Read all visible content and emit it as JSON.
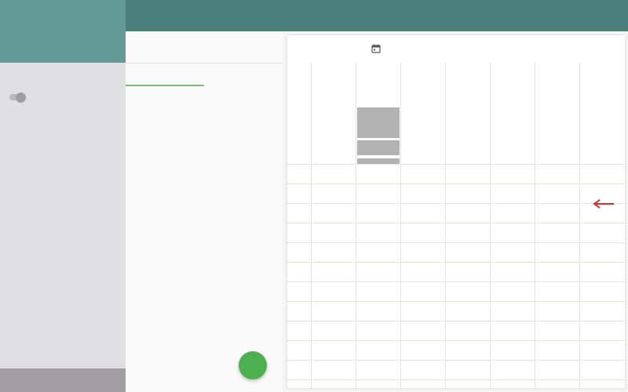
{
  "colors": {
    "topbar": "#4a7f7c",
    "sidebar_header": "#649a97",
    "sidebar": "#e0dfe1",
    "fab": "#4caf50",
    "tab_indicator": "#7dbb83",
    "event_block": "#b3b3b3",
    "arrow": "#d32f2f"
  },
  "icons": {
    "calendar": "calendar-icon",
    "arrow": "left-arrow-icon",
    "fab": "add-fab"
  },
  "sidebar": {
    "toggle_state": "off"
  }
}
